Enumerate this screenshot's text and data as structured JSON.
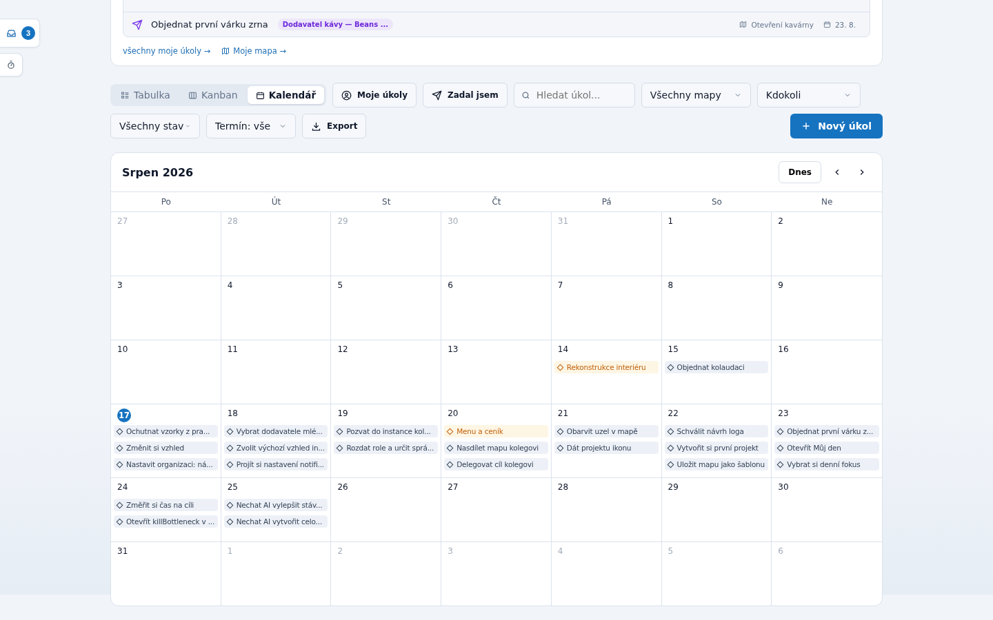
{
  "side_buttons": {
    "inbox_count": "3"
  },
  "my_tasks": {
    "rows": [
      {
        "title": "Objednat první várku zrna",
        "tag": "Dodavatel kávy — Beans ...",
        "map": "Otevření kavárny",
        "date": "23. 8.",
        "overdue": false
      }
    ],
    "links": [
      "všechny moje úkoly →",
      "Moje mapa →"
    ]
  },
  "view_tabs": [
    {
      "label": "Tabulka",
      "selected": false
    },
    {
      "label": "Kanban",
      "selected": false
    },
    {
      "label": "Kalendář",
      "selected": true
    }
  ],
  "filters": {
    "mine": "Moje úkoly",
    "assigned": "Zadal jsem",
    "search": {
      "placeholder": "Hledat úkol..."
    },
    "map_select": "Všechny mapy",
    "person_select": "Kdokoli",
    "status_select": "Všechny stav",
    "due_select": "Termín: vše",
    "export": "Export",
    "new_task": "Nový úkol"
  },
  "calendar": {
    "title": "Srpen 2026",
    "today_button": "Dnes",
    "weekdays": [
      "Po",
      "Út",
      "St",
      "Čt",
      "Pá",
      "So",
      "Ne"
    ],
    "weeks": [
      [
        {
          "day": "27",
          "muted": true,
          "today": false
        },
        {
          "day": "28",
          "muted": true,
          "today": false
        },
        {
          "day": "29",
          "muted": true,
          "today": false
        },
        {
          "day": "30",
          "muted": true,
          "today": false
        },
        {
          "day": "31",
          "muted": true,
          "today": false
        },
        {
          "day": "1",
          "muted": false,
          "today": false
        },
        {
          "day": "2",
          "muted": false,
          "today": false
        }
      ],
      [
        {
          "day": "3",
          "muted": false,
          "today": false
        },
        {
          "day": "4",
          "muted": false,
          "today": false
        },
        {
          "day": "5",
          "muted": false,
          "today": false
        },
        {
          "day": "6",
          "muted": false,
          "today": false
        },
        {
          "day": "7",
          "muted": false,
          "today": false
        },
        {
          "day": "8",
          "muted": false,
          "today": false
        },
        {
          "day": "9",
          "muted": false,
          "today": false
        }
      ],
      [
        {
          "day": "10",
          "muted": false,
          "today": false
        },
        {
          "day": "11",
          "muted": false,
          "today": false
        },
        {
          "day": "12",
          "muted": false,
          "today": false
        },
        {
          "day": "13",
          "muted": false,
          "today": false
        },
        {
          "day": "14",
          "muted": false,
          "today": false,
          "tasks": [
            {
              "title": "Rekonstrukce interiéru",
              "highlight": true
            }
          ]
        },
        {
          "day": "15",
          "muted": false,
          "today": false,
          "tasks": [
            {
              "title": "Objednat kolaudaci",
              "highlight": false
            }
          ]
        },
        {
          "day": "16",
          "muted": false,
          "today": false
        }
      ],
      [
        {
          "day": "17",
          "muted": false,
          "today": true,
          "tasks": [
            {
              "title": "Ochutnat vzorky z pra...",
              "highlight": false
            },
            {
              "title": "Změnit si vzhled",
              "highlight": false
            },
            {
              "title": "Nastavit organizaci: ná...",
              "highlight": false
            }
          ]
        },
        {
          "day": "18",
          "muted": false,
          "today": false,
          "tasks": [
            {
              "title": "Vybrat dodavatele mlé...",
              "highlight": false
            },
            {
              "title": "Zvolit výchozí vzhled in...",
              "highlight": false
            },
            {
              "title": "Projít si nastavení notifi...",
              "highlight": false
            }
          ]
        },
        {
          "day": "19",
          "muted": false,
          "today": false,
          "tasks": [
            {
              "title": "Pozvat do instance kol...",
              "highlight": false
            },
            {
              "title": "Rozdat role a určit sprá...",
              "highlight": false
            }
          ]
        },
        {
          "day": "20",
          "muted": false,
          "today": false,
          "tasks": [
            {
              "title": "Menu a ceník",
              "highlight": true
            },
            {
              "title": "Nasdílet mapu kolegovi",
              "highlight": false
            },
            {
              "title": "Delegovat cíl kolegovi",
              "highlight": false
            }
          ]
        },
        {
          "day": "21",
          "muted": false,
          "today": false,
          "tasks": [
            {
              "title": "Obarvit uzel v mapě",
              "highlight": false
            },
            {
              "title": "Dát projektu ikonu",
              "highlight": false
            }
          ]
        },
        {
          "day": "22",
          "muted": false,
          "today": false,
          "tasks": [
            {
              "title": "Schválit návrh loga",
              "highlight": false
            },
            {
              "title": "Vytvořit si první projekt",
              "highlight": false
            },
            {
              "title": "Uložit mapu jako šablonu",
              "highlight": false
            }
          ]
        },
        {
          "day": "23",
          "muted": false,
          "today": false,
          "tasks": [
            {
              "title": "Objednat první várku z...",
              "highlight": false
            },
            {
              "title": "Otevřít Můj den",
              "highlight": false
            },
            {
              "title": "Vybrat si denní fokus",
              "highlight": false
            }
          ]
        }
      ],
      [
        {
          "day": "24",
          "muted": false,
          "today": false,
          "tasks": [
            {
              "title": "Změřit si čas na cíli",
              "highlight": false
            },
            {
              "title": "Otevřít killBottleneck v ...",
              "highlight": false
            }
          ]
        },
        {
          "day": "25",
          "muted": false,
          "today": false,
          "tasks": [
            {
              "title": "Nechat AI vylepšit stáv...",
              "highlight": false
            },
            {
              "title": "Nechat AI vytvořit celo...",
              "highlight": false
            }
          ]
        },
        {
          "day": "26",
          "muted": false,
          "today": false
        },
        {
          "day": "27",
          "muted": false,
          "today": false
        },
        {
          "day": "28",
          "muted": false,
          "today": false
        },
        {
          "day": "29",
          "muted": false,
          "today": false
        },
        {
          "day": "30",
          "muted": false,
          "today": false
        }
      ],
      [
        {
          "day": "31",
          "muted": false,
          "today": false
        },
        {
          "day": "1",
          "muted": true,
          "today": false
        },
        {
          "day": "2",
          "muted": true,
          "today": false
        },
        {
          "day": "3",
          "muted": true,
          "today": false
        },
        {
          "day": "4",
          "muted": true,
          "today": false
        },
        {
          "day": "5",
          "muted": true,
          "today": false
        },
        {
          "day": "6",
          "muted": true,
          "today": false
        }
      ]
    ]
  }
}
